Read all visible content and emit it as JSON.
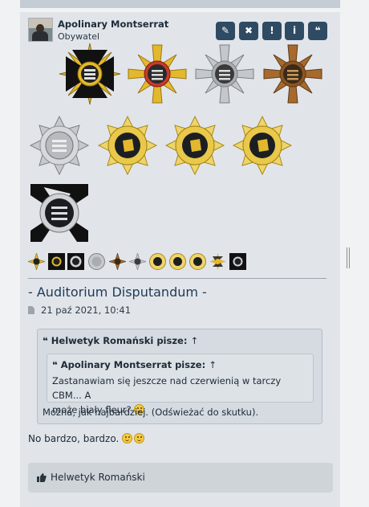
{
  "post": {
    "author": "Apolinary Montserrat",
    "rank": "Obywatel",
    "actions": [
      {
        "icon": "pencil-icon",
        "glyph": "✎"
      },
      {
        "icon": "close-icon",
        "glyph": "✖"
      },
      {
        "icon": "exclamation-icon",
        "glyph": "!"
      },
      {
        "icon": "info-icon",
        "glyph": "i"
      },
      {
        "icon": "quote-icon",
        "glyph": "❝"
      }
    ],
    "medals": [
      {
        "icon": "black-gold-cross-medal-icon"
      },
      {
        "icon": "gold-cross-red-ring-medal-icon"
      },
      {
        "icon": "silver-cross-medal-icon"
      },
      {
        "icon": "bronze-cross-medal-icon"
      },
      {
        "icon": "silver-star-medal-icon"
      },
      {
        "icon": "gold-star-medal-icon"
      },
      {
        "icon": "gold-star-medal-icon"
      },
      {
        "icon": "gold-star-medal-icon"
      },
      {
        "icon": "black-silver-cross-medal-icon"
      }
    ],
    "ribbons": [
      "gold-cross-mini-icon",
      "black-cross-mini-icon",
      "black-silver-cross-mini-icon",
      "silver-star-mini-icon",
      "bronze-cross-mini-icon",
      "silver-cross-mini-icon",
      "gold-star-mini-icon",
      "gold-star-mini-icon",
      "gold-star-mini-icon",
      "black-gold-cross-mini-icon",
      "black-cross-mini-icon"
    ],
    "title": "- Auditorium Disputandum -",
    "date": "21 paź 2021, 10:41",
    "outer_quote": {
      "author_line": "Helwetyk Romański pisze:",
      "arrow": "↑",
      "text": "Można, jak najbardziej. (Odświeżać do skutku)."
    },
    "inner_quote": {
      "author_line": "Apolinary Montserrat pisze:",
      "arrow": "↑",
      "line1": "Zastanawiam się jeszcze nad czerwienią w tarczy CBM... A",
      "line2": "może biały fleur?"
    },
    "body": "No bardzo, bardzo.",
    "likes": "Helwetyk Romański"
  },
  "colors": {
    "post_bg": "#e1e5ea",
    "button_bg": "#2f4b63",
    "title": "#1f3a57",
    "gold": "#e3b82c",
    "silver": "#b9bcc0",
    "bronze": "#a66a2f",
    "black": "#111111"
  }
}
